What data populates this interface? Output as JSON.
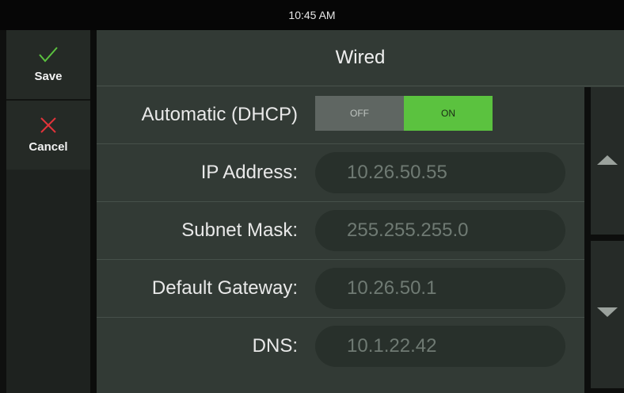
{
  "status_bar": {
    "time": "10:45 AM"
  },
  "sidebar": {
    "save_label": "Save",
    "cancel_label": "Cancel",
    "save_icon": "checkmark-icon",
    "cancel_icon": "x-close-icon",
    "save_icon_color": "#5bc23f",
    "cancel_icon_color": "#e2333a"
  },
  "page": {
    "title": "Wired"
  },
  "dhcp": {
    "label": "Automatic (DHCP)",
    "off_label": "OFF",
    "on_label": "ON",
    "state": "ON",
    "on_color": "#5bc23f"
  },
  "fields": {
    "ip_address": {
      "label": "IP Address:",
      "value": "10.26.50.55"
    },
    "subnet_mask": {
      "label": "Subnet Mask:",
      "value": "255.255.255.0"
    },
    "default_gateway": {
      "label": "Default Gateway:",
      "value": "10.26.50.1"
    },
    "dns": {
      "label": "DNS:",
      "value": "10.1.22.42"
    }
  },
  "scroll": {
    "up_icon": "arrow-up-icon",
    "down_icon": "arrow-down-icon"
  }
}
